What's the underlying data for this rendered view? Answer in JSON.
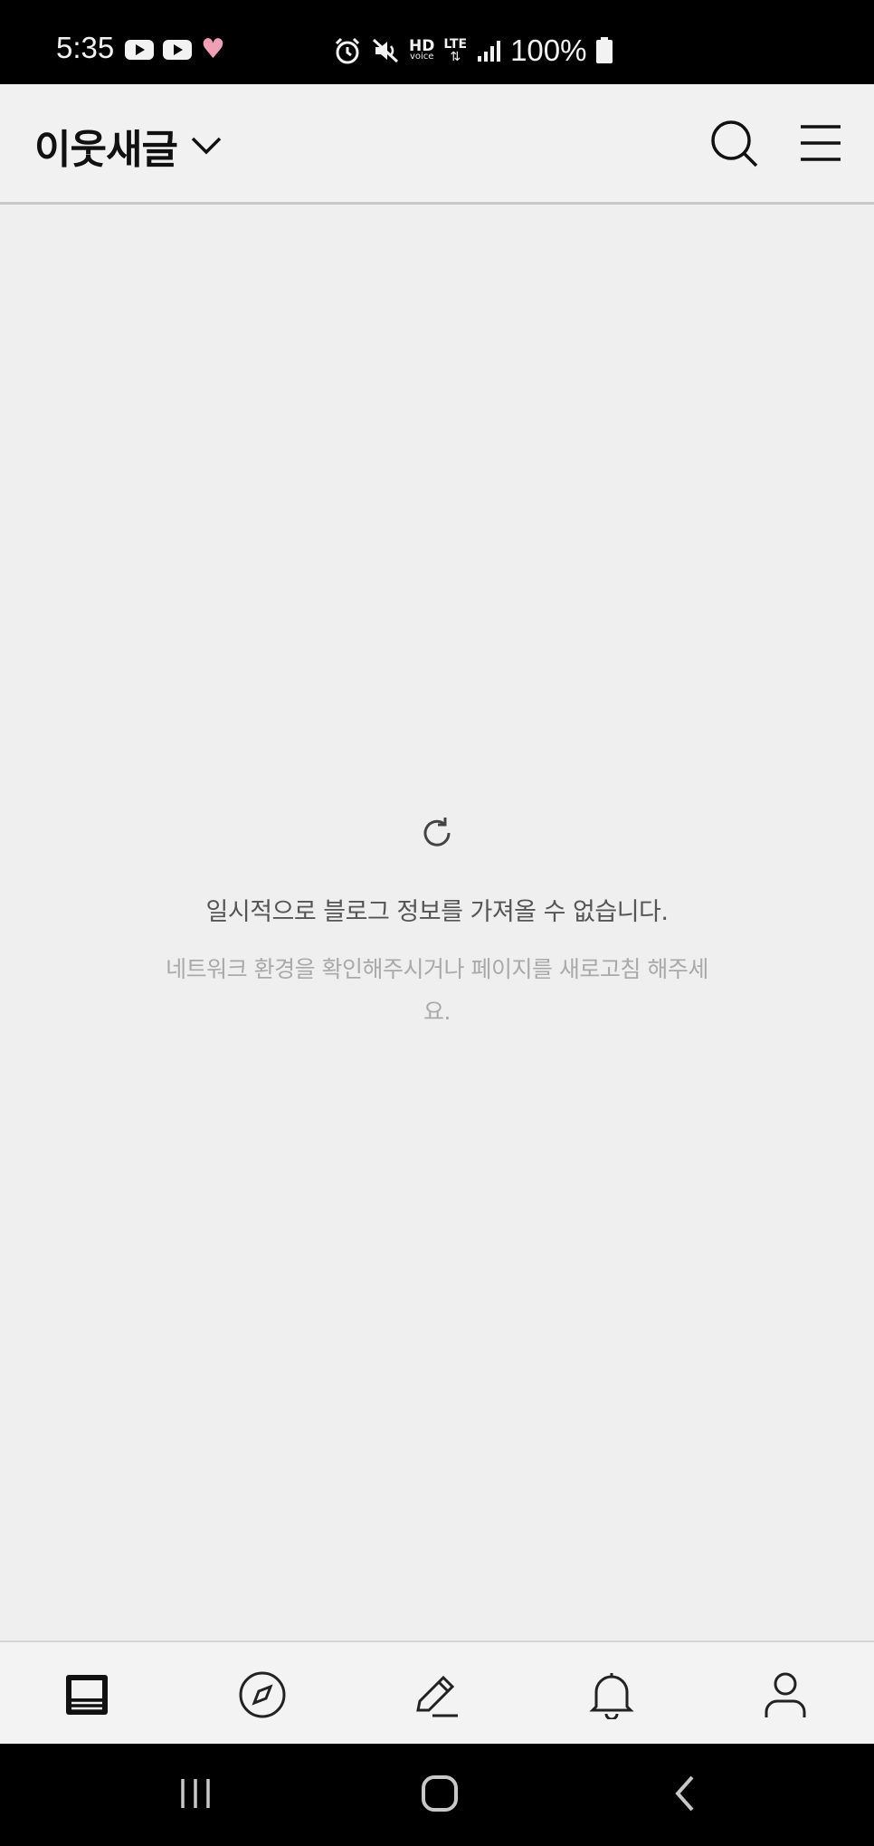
{
  "status_bar": {
    "time": "5:35",
    "battery": "100%",
    "hd_label": "HD",
    "voice_label": "voice",
    "lte_label": "LTE",
    "icons": [
      "youtube-icon",
      "youtube-icon",
      "heart-icon",
      "alarm-icon",
      "mute-icon",
      "signal-icon",
      "battery-icon"
    ]
  },
  "header": {
    "title": "이웃새글",
    "icons": [
      "chevron-down-icon",
      "search-icon",
      "menu-icon"
    ]
  },
  "main": {
    "error_title": "일시적으로 블로그 정보를 가져올 수 없습니다.",
    "error_message": "네트워크 환경을 확인해주시거나 페이지를 새로고침 해주세요.",
    "icon": "reload-icon"
  },
  "bottom_nav": {
    "items": [
      "feed-icon",
      "explore-icon",
      "write-icon",
      "notification-icon",
      "profile-icon"
    ]
  },
  "system_nav": {
    "items": [
      "recent-apps-icon",
      "home-icon",
      "back-icon"
    ]
  },
  "colors": {
    "background": "#efefef",
    "status_bar": "#000000",
    "text_primary": "#111111",
    "text_secondary": "#555555",
    "text_muted": "#a9a9a9"
  }
}
